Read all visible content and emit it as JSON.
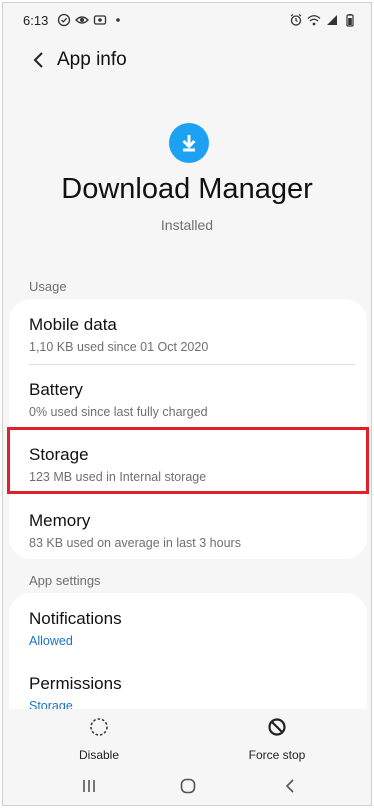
{
  "status_bar": {
    "time": "6:13",
    "left_icons": [
      "check-circle-icon",
      "eye-icon",
      "screen-record-icon",
      "dot-icon"
    ],
    "right_icons": [
      "alarm-icon",
      "wifi-icon",
      "signal-icon",
      "battery-icon"
    ]
  },
  "header": {
    "title": "App info",
    "back_icon": "back-arrow-icon"
  },
  "app": {
    "name": "Download Manager",
    "status": "Installed",
    "icon": "download-icon",
    "icon_color": "#1da1f2"
  },
  "usage": {
    "label": "Usage",
    "items": [
      {
        "title": "Mobile data",
        "subtitle": "1,10 KB used since 01 Oct 2020"
      },
      {
        "title": "Battery",
        "subtitle": "0% used since last fully charged"
      },
      {
        "title": "Storage",
        "subtitle": "123 MB used in Internal storage"
      },
      {
        "title": "Memory",
        "subtitle": "83 KB used on average in last 3 hours"
      }
    ]
  },
  "app_settings": {
    "label": "App settings",
    "items": [
      {
        "title": "Notifications",
        "subtitle": "Allowed"
      },
      {
        "title": "Permissions",
        "subtitle": "Storage"
      }
    ]
  },
  "actions": {
    "disable_label": "Disable",
    "force_stop_label": "Force stop"
  },
  "nav": {
    "recents_icon": "recents-icon",
    "home_icon": "home-icon",
    "back_icon": "nav-back-icon"
  },
  "colors": {
    "accent": "#1a73c8",
    "highlight": "#e0202a"
  }
}
